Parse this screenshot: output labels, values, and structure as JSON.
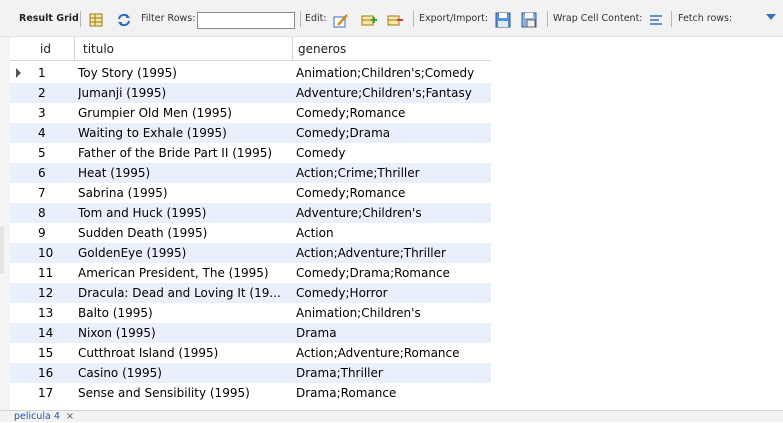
{
  "toolbar": {
    "result_grid_label": "Result Grid",
    "filter_rows_label": "Filter Rows:",
    "filter_rows_value": "",
    "edit_label": "Edit:",
    "export_import_label": "Export/Import:",
    "wrap_cell_content_label": "Wrap Cell Content:",
    "fetch_rows_label": "Fetch rows:"
  },
  "grid": {
    "columns": [
      "id",
      "titulo",
      "generos"
    ],
    "rows": [
      {
        "id": "1",
        "titulo": "Toy Story (1995)",
        "generos": "Animation;Children's;Comedy"
      },
      {
        "id": "2",
        "titulo": "Jumanji (1995)",
        "generos": "Adventure;Children's;Fantasy"
      },
      {
        "id": "3",
        "titulo": "Grumpier Old Men (1995)",
        "generos": "Comedy;Romance"
      },
      {
        "id": "4",
        "titulo": "Waiting to Exhale (1995)",
        "generos": "Comedy;Drama"
      },
      {
        "id": "5",
        "titulo": "Father of the Bride Part II (1995)",
        "generos": "Comedy"
      },
      {
        "id": "6",
        "titulo": "Heat (1995)",
        "generos": "Action;Crime;Thriller"
      },
      {
        "id": "7",
        "titulo": "Sabrina (1995)",
        "generos": "Comedy;Romance"
      },
      {
        "id": "8",
        "titulo": "Tom and Huck (1995)",
        "generos": "Adventure;Children's"
      },
      {
        "id": "9",
        "titulo": "Sudden Death (1995)",
        "generos": "Action"
      },
      {
        "id": "10",
        "titulo": "GoldenEye (1995)",
        "generos": "Action;Adventure;Thriller"
      },
      {
        "id": "11",
        "titulo": "American President, The (1995)",
        "generos": "Comedy;Drama;Romance"
      },
      {
        "id": "12",
        "titulo": "Dracula: Dead and Loving It (19...",
        "generos": "Comedy;Horror"
      },
      {
        "id": "13",
        "titulo": "Balto (1995)",
        "generos": "Animation;Children's"
      },
      {
        "id": "14",
        "titulo": "Nixon (1995)",
        "generos": "Drama"
      },
      {
        "id": "15",
        "titulo": "Cutthroat Island (1995)",
        "generos": "Action;Adventure;Romance"
      },
      {
        "id": "16",
        "titulo": "Casino (1995)",
        "generos": "Drama;Thriller"
      },
      {
        "id": "17",
        "titulo": "Sense and Sensibility (1995)",
        "generos": "Drama;Romance"
      }
    ]
  },
  "tabs": [
    {
      "label": "pelicula 4",
      "close": "×"
    }
  ],
  "colors": {
    "accent": "#3a6fc4",
    "row_alt": "#eaf0fb"
  },
  "icons": [
    "grid-form-icon",
    "refresh-icon",
    "edit-row-icon",
    "add-row-icon",
    "delete-row-icon",
    "export-icon",
    "import-icon",
    "wrap-text-icon",
    "dropdown-icon",
    "row-arrow-icon"
  ]
}
